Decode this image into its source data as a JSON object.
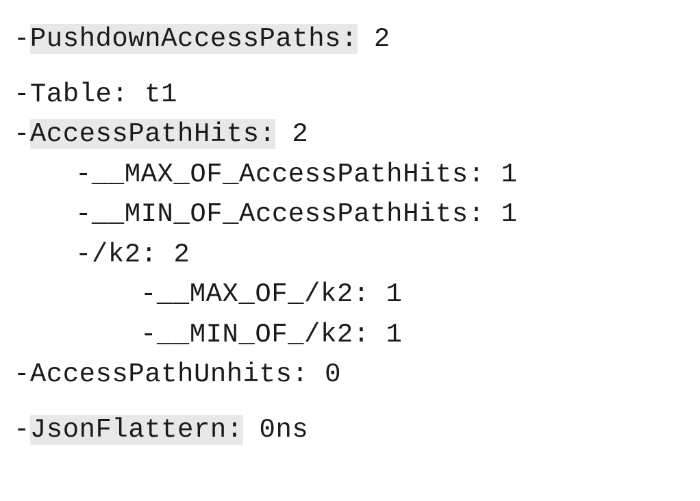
{
  "lines": {
    "l1_label": "PushdownAccessPaths:",
    "l1_value": " 2",
    "l2_text": "Table: t1",
    "l3_label": "AccessPathHits:",
    "l3_value": " 2",
    "l4_text": "__MAX_OF_AccessPathHits: 1",
    "l5_text": "__MIN_OF_AccessPathHits: 1",
    "l6_text": "/k2: 2",
    "l7_text": "__MAX_OF_/k2: 1",
    "l8_text": "__MIN_OF_/k2: 1",
    "l9_text": "AccessPathUnhits: 0",
    "l10_label": "JsonFlattern:",
    "l10_value": " 0ns"
  },
  "bullet": "- "
}
